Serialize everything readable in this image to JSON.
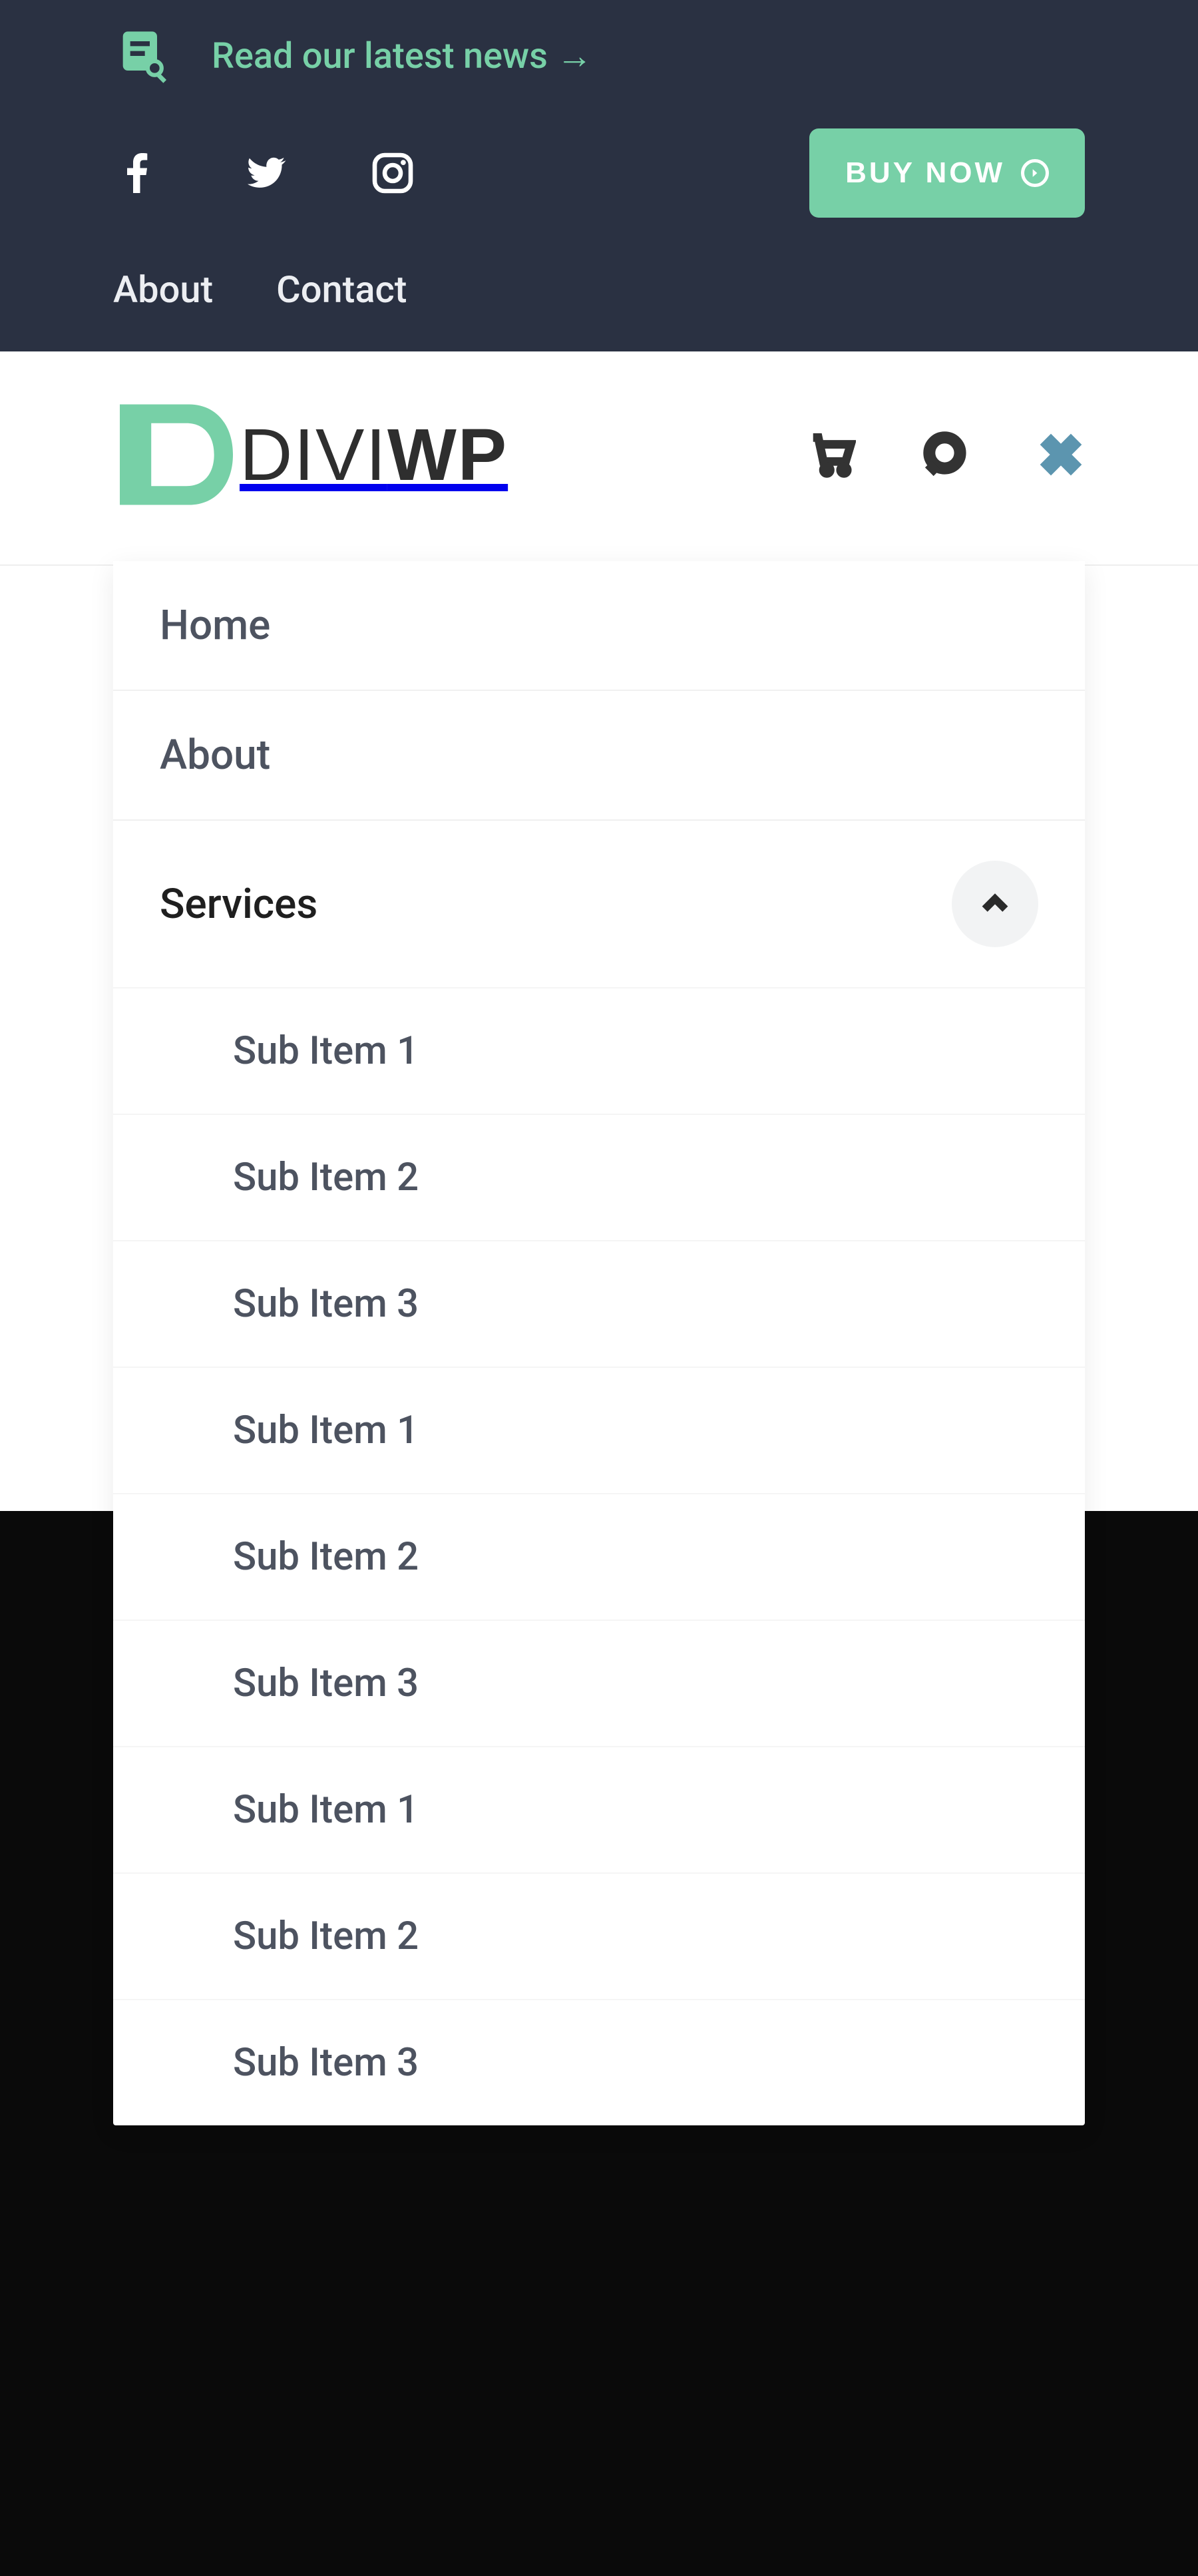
{
  "topbar": {
    "news_text": "Read our latest news →",
    "buy_label": "BUY NOW",
    "links": {
      "about": "About",
      "contact": "Contact"
    }
  },
  "logo": {
    "part1": "DIVI",
    "part2": "WP"
  },
  "menu": {
    "items": [
      {
        "label": "Home"
      },
      {
        "label": "About"
      },
      {
        "label": "Services",
        "active": true
      }
    ],
    "sub_items": [
      "Sub Item 1",
      "Sub Item 2",
      "Sub Item 3",
      "Sub Item 1",
      "Sub Item 2",
      "Sub Item 3",
      "Sub Item 1",
      "Sub Item 2",
      "Sub Item 3"
    ]
  }
}
